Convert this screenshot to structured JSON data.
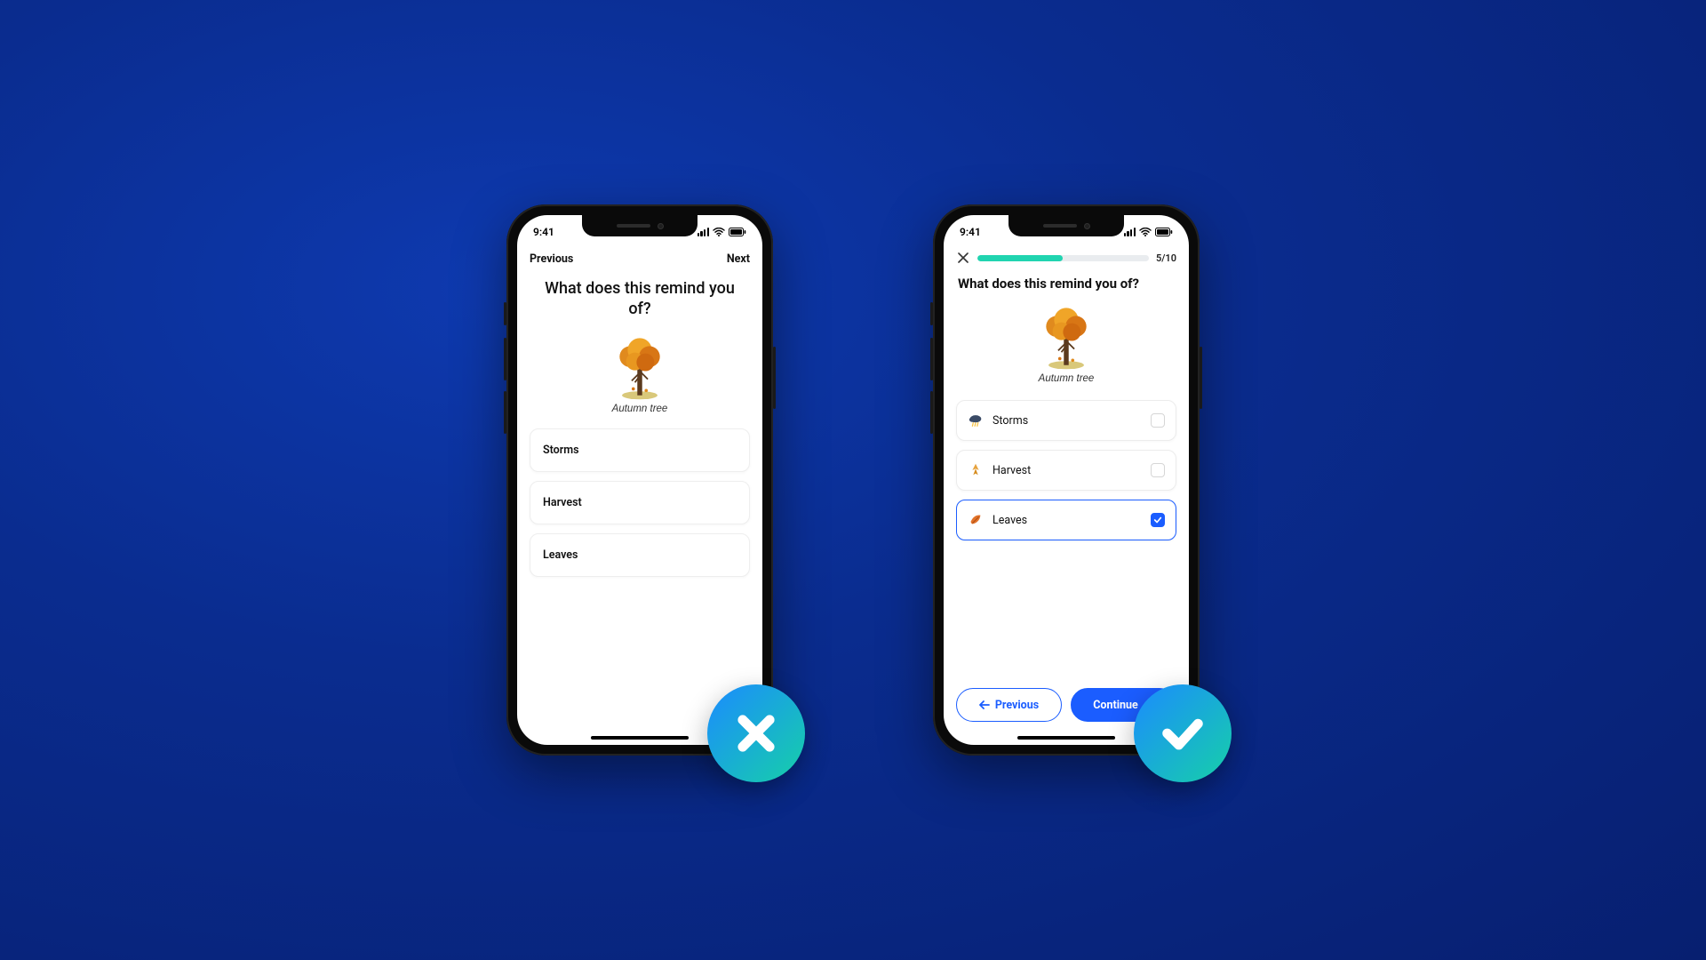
{
  "status": {
    "time": "9:41"
  },
  "left": {
    "nav_prev": "Previous",
    "nav_next": "Next",
    "question": "What does this remind you of?",
    "tree_caption": "Autumn tree",
    "options": [
      "Storms",
      "Harvest",
      "Leaves"
    ],
    "badge": "cross"
  },
  "right": {
    "progress_label": "5/10",
    "progress_percent": 50,
    "question": "What does this remind you of?",
    "tree_caption": "Autumn tree",
    "options": [
      {
        "icon": "cloud",
        "label": "Storms",
        "selected": false
      },
      {
        "icon": "wheat",
        "label": "Harvest",
        "selected": false
      },
      {
        "icon": "leaf",
        "label": "Leaves",
        "selected": true
      }
    ],
    "btn_prev": "Previous",
    "btn_continue": "Continue",
    "badge": "check"
  },
  "colors": {
    "accent_blue": "#1b5dff",
    "accent_teal": "#20d4b0"
  }
}
